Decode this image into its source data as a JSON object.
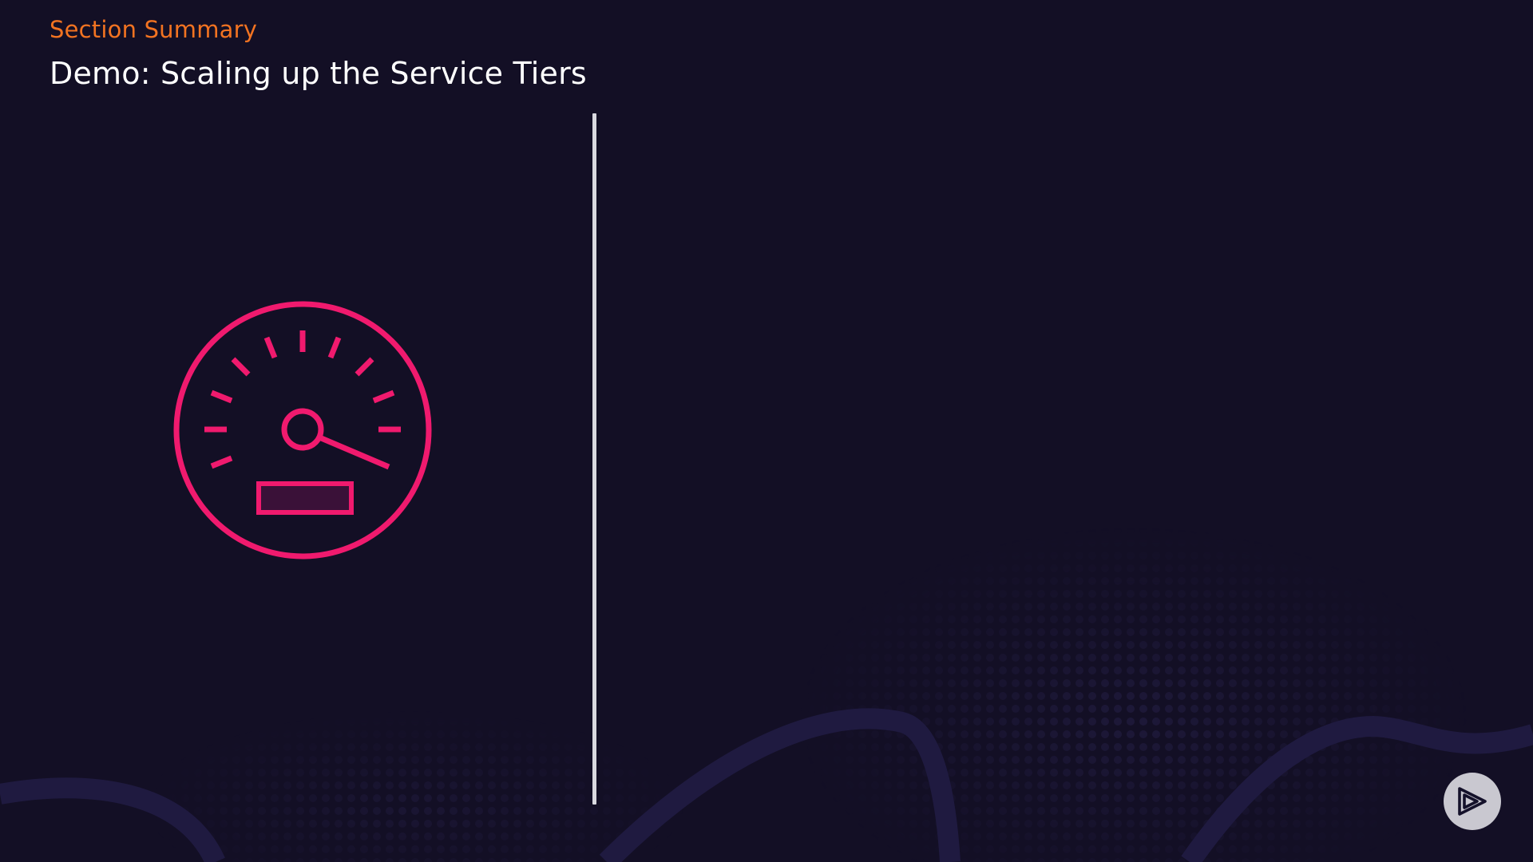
{
  "header": {
    "section_label": "Section Summary",
    "title": "Demo: Scaling up the Service Tiers"
  },
  "icons": {
    "main": "speedometer-icon",
    "corner": "play-logo-icon"
  },
  "colors": {
    "background": "#130f25",
    "accent_orange": "#f27321",
    "accent_pink": "#f01a6e",
    "title_white": "#ffffff",
    "divider": "#d9d9e0"
  }
}
